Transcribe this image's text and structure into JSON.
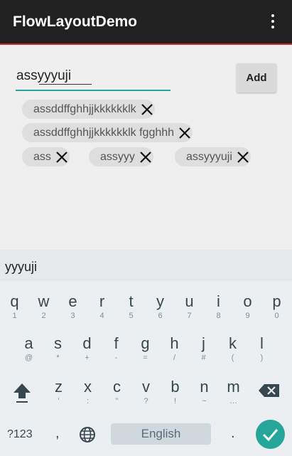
{
  "app": {
    "title": "FlowLayoutDemo",
    "menu_icon": "more-vert-icon"
  },
  "input": {
    "value": "assyyyuji",
    "placeholder": ""
  },
  "add_button": {
    "label": "Add"
  },
  "tags": [
    {
      "label": "assddffghhjjkkkkkklk"
    },
    {
      "label": "assddffghhjjkkkkkklk fgghhh"
    },
    {
      "label": "ass"
    },
    {
      "label": "assyyy"
    },
    {
      "label": "assyyyuji"
    }
  ],
  "keyboard": {
    "suggestion": "yyyuji",
    "row1": [
      {
        "key": "q",
        "hint": "1"
      },
      {
        "key": "w",
        "hint": "2"
      },
      {
        "key": "e",
        "hint": "3"
      },
      {
        "key": "r",
        "hint": "4"
      },
      {
        "key": "t",
        "hint": "5"
      },
      {
        "key": "y",
        "hint": "6"
      },
      {
        "key": "u",
        "hint": "7"
      },
      {
        "key": "i",
        "hint": "8"
      },
      {
        "key": "o",
        "hint": "9"
      },
      {
        "key": "p",
        "hint": "0"
      }
    ],
    "row2": [
      {
        "key": "a",
        "hint": "@"
      },
      {
        "key": "s",
        "hint": "*"
      },
      {
        "key": "d",
        "hint": "+"
      },
      {
        "key": "f",
        "hint": "-"
      },
      {
        "key": "g",
        "hint": "="
      },
      {
        "key": "h",
        "hint": "/"
      },
      {
        "key": "j",
        "hint": "#"
      },
      {
        "key": "k",
        "hint": "("
      },
      {
        "key": "l",
        "hint": ")"
      }
    ],
    "row3": [
      {
        "key": "z",
        "hint": "'"
      },
      {
        "key": "x",
        "hint": ":"
      },
      {
        "key": "c",
        "hint": "\""
      },
      {
        "key": "v",
        "hint": "?"
      },
      {
        "key": "b",
        "hint": "!"
      },
      {
        "key": "n",
        "hint": "~"
      },
      {
        "key": "m",
        "hint": "…"
      }
    ],
    "symbols_label": "?123",
    "comma": ",",
    "space_label": "English",
    "period": "."
  },
  "colors": {
    "appbar": "#212121",
    "accent": "#26a69a",
    "appbar_border": "#c62828",
    "tag_bg": "#dedede"
  }
}
